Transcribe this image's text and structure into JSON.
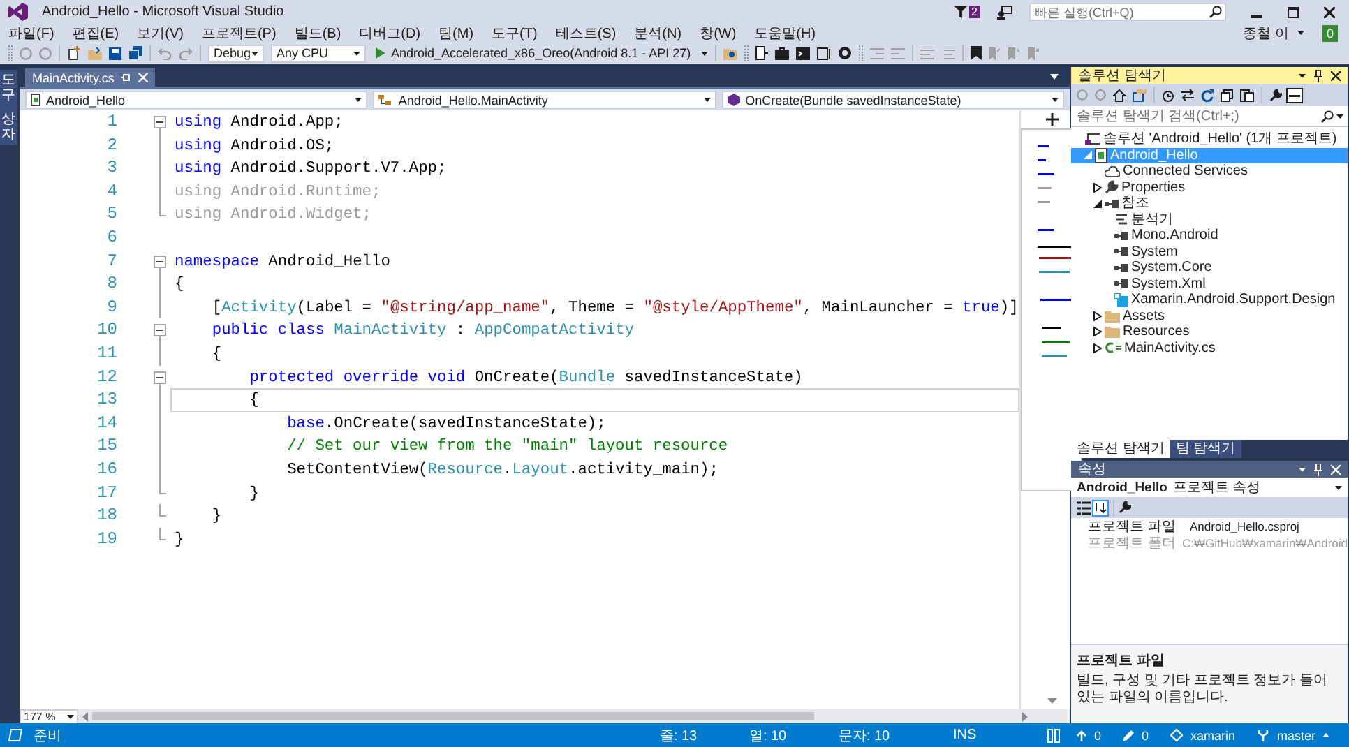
{
  "window": {
    "title": "Android_Hello - Microsoft Visual Studio",
    "notification_count": "2",
    "quick_launch": {
      "placeholder": "빠른 실행(Ctrl+Q)"
    },
    "user": "종철 이",
    "badge": "0"
  },
  "menu": [
    "파일(F)",
    "편집(E)",
    "보기(V)",
    "프로젝트(P)",
    "빌드(B)",
    "디버그(D)",
    "팀(M)",
    "도구(T)",
    "테스트(S)",
    "분석(N)",
    "창(W)",
    "도움말(H)"
  ],
  "toolbar": {
    "configuration": "Debug",
    "platform": "Any CPU",
    "target": "Android_Accelerated_x86_Oreo(Android 8.1 - API 27)"
  },
  "toolbox_tab": "도구 상자",
  "document_tabs": [
    {
      "label": "MainActivity.cs",
      "selected": true
    }
  ],
  "navigation": [
    "Android_Hello",
    "Android_Hello.MainActivity",
    "OnCreate(Bundle savedInstanceState)"
  ],
  "editor": {
    "zoom": "177 %",
    "lines": [
      {
        "number": "1",
        "kind": "start",
        "current": false,
        "tokens": [
          {
            "kind": "keyword",
            "text": "using"
          },
          {
            "kind": "plain",
            "text": " Android.App;"
          }
        ]
      },
      {
        "number": "2",
        "kind": "body",
        "current": false,
        "tokens": [
          {
            "kind": "keyword",
            "text": "using"
          },
          {
            "kind": "plain",
            "text": " Android.OS;"
          }
        ]
      },
      {
        "number": "3",
        "kind": "body",
        "current": false,
        "tokens": [
          {
            "kind": "keyword",
            "text": "using"
          },
          {
            "kind": "plain",
            "text": " Android.Support.V7.App;"
          }
        ]
      },
      {
        "number": "4",
        "kind": "body",
        "current": false,
        "tokens": [
          {
            "kind": "unused",
            "text": "using Android.Runtime;"
          }
        ]
      },
      {
        "number": "5",
        "kind": "end",
        "current": false,
        "tokens": [
          {
            "kind": "unused",
            "text": "using Android.Widget;"
          }
        ]
      },
      {
        "number": "6",
        "kind": "blank",
        "current": false
      },
      {
        "number": "7",
        "kind": "start",
        "current": false,
        "tokens": [
          {
            "kind": "keyword",
            "text": "namespace"
          },
          {
            "kind": "plain",
            "text": " Android_Hello"
          }
        ]
      },
      {
        "number": "8",
        "kind": "body",
        "current": false,
        "tokens": [
          {
            "kind": "plain",
            "text": "{"
          }
        ]
      },
      {
        "number": "9",
        "kind": "body",
        "current": false,
        "tokens": [
          {
            "kind": "plain",
            "text": "    ["
          },
          {
            "kind": "type",
            "text": "Activity"
          },
          {
            "kind": "plain",
            "text": "(Label = "
          },
          {
            "kind": "string",
            "text": "\"@string/app_name\""
          },
          {
            "kind": "plain",
            "text": ", Theme = "
          },
          {
            "kind": "string",
            "text": "\"@style/AppTheme\""
          },
          {
            "kind": "plain",
            "text": ", MainLauncher = "
          },
          {
            "kind": "keyword",
            "text": "true"
          },
          {
            "kind": "plain",
            "text": ")]"
          }
        ]
      },
      {
        "number": "10",
        "kind": "start",
        "current": false,
        "tokens": [
          {
            "kind": "keyword",
            "text": "    public class "
          },
          {
            "kind": "type",
            "text": "MainActivity"
          },
          {
            "kind": "plain",
            "text": " : "
          },
          {
            "kind": "type",
            "text": "AppCompatActivity"
          }
        ]
      },
      {
        "number": "11",
        "kind": "body",
        "current": false,
        "tokens": [
          {
            "kind": "plain",
            "text": "    {"
          }
        ]
      },
      {
        "number": "12",
        "kind": "start",
        "current": false,
        "tokens": [
          {
            "kind": "keyword",
            "text": "        protected override void"
          },
          {
            "kind": "plain",
            "text": " OnCreate("
          },
          {
            "kind": "type",
            "text": "Bundle"
          },
          {
            "kind": "plain",
            "text": " savedInstanceState)"
          }
        ]
      },
      {
        "number": "13",
        "kind": "body",
        "current": true,
        "tokens": [
          {
            "kind": "plain",
            "text": "        {"
          }
        ]
      },
      {
        "number": "14",
        "kind": "body",
        "current": false,
        "tokens": [
          {
            "kind": "keyword",
            "text": "            base"
          },
          {
            "kind": "plain",
            "text": ".OnCreate(savedInstanceState);"
          }
        ]
      },
      {
        "number": "15",
        "kind": "body",
        "current": false,
        "tokens": [
          {
            "kind": "comment",
            "text": "            // Set our view from the \"main\" layout resource"
          }
        ]
      },
      {
        "number": "16",
        "kind": "body",
        "current": false,
        "tokens": [
          {
            "kind": "plain",
            "text": "            SetContentView("
          },
          {
            "kind": "type",
            "text": "Resource"
          },
          {
            "kind": "plain",
            "text": "."
          },
          {
            "kind": "type",
            "text": "Layout"
          },
          {
            "kind": "plain",
            "text": ".activity_main);"
          }
        ]
      },
      {
        "number": "17",
        "kind": "end",
        "current": false,
        "tokens": [
          {
            "kind": "plain",
            "text": "        }"
          }
        ]
      },
      {
        "number": "18",
        "kind": "end",
        "current": false,
        "tokens": [
          {
            "kind": "plain",
            "text": "    }"
          }
        ]
      },
      {
        "number": "19",
        "kind": "end",
        "current": false,
        "tokens": [
          {
            "kind": "plain",
            "text": "}"
          }
        ]
      }
    ]
  },
  "solution_explorer": {
    "title": "솔루션 탐색기",
    "search": {
      "placeholder": "솔루션 탐색기 검색(Ctrl+;)"
    },
    "tree": [
      {
        "label": "솔루션 'Android_Hello' (1개 프로젝트)",
        "kind": "solution",
        "selected": false,
        "children": [
          {
            "label": "Android_Hello",
            "kind": "project",
            "expanded": true,
            "selected": true,
            "children": [
              {
                "label": "Connected Services",
                "kind": "service",
                "selected": false
              },
              {
                "label": "Properties",
                "kind": "wrench",
                "expanded": false,
                "selected": false
              },
              {
                "label": "참조",
                "kind": "reference",
                "expanded": true,
                "selected": false,
                "children": [
                  {
                    "label": "분석기",
                    "kind": "analyzer",
                    "selected": false
                  },
                  {
                    "label": "Mono.Android",
                    "kind": "reference",
                    "selected": false
                  },
                  {
                    "label": "System",
                    "kind": "reference",
                    "selected": false
                  },
                  {
                    "label": "System.Core",
                    "kind": "reference",
                    "selected": false
                  },
                  {
                    "label": "System.Xml",
                    "kind": "reference",
                    "selected": false
                  },
                  {
                    "label": "Xamarin.Android.Support.Design",
                    "kind": "package",
                    "selected": false
                  }
                ]
              },
              {
                "label": "Assets",
                "kind": "folder",
                "expanded": false,
                "selected": false
              },
              {
                "label": "Resources",
                "kind": "folder",
                "expanded": false,
                "selected": false
              },
              {
                "label": "MainActivity.cs",
                "kind": "csharp",
                "expanded": false,
                "selected": false
              }
            ]
          }
        ]
      }
    ],
    "tabs": [
      {
        "label": "솔루션 탐색기",
        "selected": true
      },
      {
        "label": "팀 탐색기",
        "selected": false
      }
    ]
  },
  "properties": {
    "title": "속성",
    "object": "Android_Hello",
    "object_kind": "프로젝트 속성",
    "rows": [
      {
        "name": "프로젝트 파일",
        "value": "Android_Hello.csproj",
        "disabled": false
      },
      {
        "name": "프로젝트 폴더",
        "value": "C:₩GitHub₩xamarin₩Android",
        "disabled": true
      }
    ],
    "description_title": "프로젝트 파일",
    "description": "빌드, 구성 및 기타 프로젝트 정보가 들어 있는 파일의 이름입니다."
  },
  "status_bar": {
    "message": "준비",
    "line": "줄: 13",
    "column": "열: 10",
    "char": "문자: 10",
    "mode": "INS",
    "unpublished": "0",
    "changes": "0",
    "repository": "xamarin",
    "branch": "master"
  }
}
